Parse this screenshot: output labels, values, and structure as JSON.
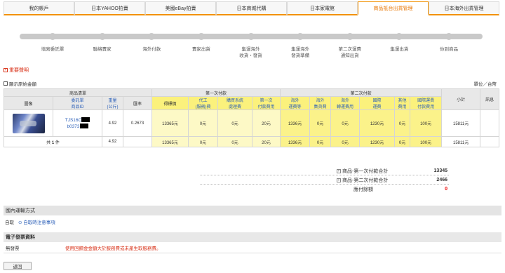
{
  "tabs": [
    {
      "label": "我的帳戶"
    },
    {
      "label": "日本YAHOO拍賣"
    },
    {
      "label": "美國eBay拍賣"
    },
    {
      "label": "日本商城代購"
    },
    {
      "label": "日本家電館"
    },
    {
      "label": "商品抵台出貨管理"
    },
    {
      "label": "日本海外出貨管理"
    }
  ],
  "active_tab_index": 5,
  "progress_steps": [
    {
      "label": "填寫委託單"
    },
    {
      "label": "聯絡賣家"
    },
    {
      "label": "海外付款"
    },
    {
      "label": "賣家出貨"
    },
    {
      "label": "集運海外\n收貨・發貨"
    },
    {
      "label": "集運海外\n發貨準備"
    },
    {
      "label": "第二次運費\n通知出貨"
    },
    {
      "label": "集運出貨"
    },
    {
      "label": "你到商品"
    }
  ],
  "important_notice": "重要聲明",
  "show_original_label": "顯示原始金額",
  "unit_label": "單位／台幣",
  "table": {
    "group_headers": {
      "product_list": "商品清單",
      "first_payment": "第一次付款",
      "second_payment": "第二次付款"
    },
    "columns": {
      "image": "圖像",
      "order_no": "委託單\n商品ID",
      "weight": "重量\n(公斤)",
      "rate": "匯率",
      "bid_price": "得標價",
      "proxy_fee": "代工\n(服務)費",
      "service_fee": "購買系統\n處理費",
      "first_subtotal": "第一次\n付款費用",
      "overseas_ship": "海外\n運費等",
      "local_ship": "海外\n集貨費",
      "overseas_agency": "海外\n轉運費用",
      "intl_ship": "國際\n運費",
      "other_fee": "其他\n費用",
      "intl_handling": "國際運費\n付款費用",
      "subtotal": "小計",
      "note": "訊息"
    },
    "rows": [
      {
        "order_id_prefix": "TJS16C",
        "item_id_prefix": "b0373",
        "weight": "4.92",
        "rate": "0.2673",
        "bid_price": "13365元",
        "proxy_fee": "0元",
        "service_fee": "0元",
        "first_subtotal": "20元",
        "overseas_ship": "1336元",
        "local_ship": "0元",
        "overseas_agency": "0元",
        "intl_ship": "1230元",
        "other_fee": "0元",
        "intl_handling": "100元",
        "subtotal": "15811元",
        "note": ""
      }
    ],
    "total_row": {
      "label_prefix": "共",
      "count": "1",
      "label_suffix": "件",
      "weight": "4.92",
      "bid_price": "13365元",
      "proxy_fee": "0元",
      "service_fee": "0元",
      "first_subtotal": "20元",
      "overseas_ship": "1336元",
      "local_ship": "0元",
      "overseas_agency": "0元",
      "intl_ship": "1230元",
      "other_fee": "0元",
      "intl_handling": "100元",
      "subtotal": "15811元"
    }
  },
  "summary": {
    "first_total_label": "商品-第一次付款合計",
    "first_total_value": "13345",
    "second_total_label": "商品-第二次付款合計",
    "second_total_value": "2466",
    "due_label": "應付餘額",
    "due_value": "0"
  },
  "domestic_shipping": {
    "title": "國內運輸方式",
    "method": "自取",
    "notice_link": "自取時注意事項"
  },
  "invoice": {
    "title": "電子發票資料",
    "type": "無發票",
    "warning": "使用回饋金金額大於服務費或未產生取服務費。"
  },
  "back_button": "返回",
  "colors": {
    "accent": "#f29100",
    "warning": "#d9331a",
    "link": "#2b5fb8",
    "yellow_header": "#fbf17c"
  }
}
